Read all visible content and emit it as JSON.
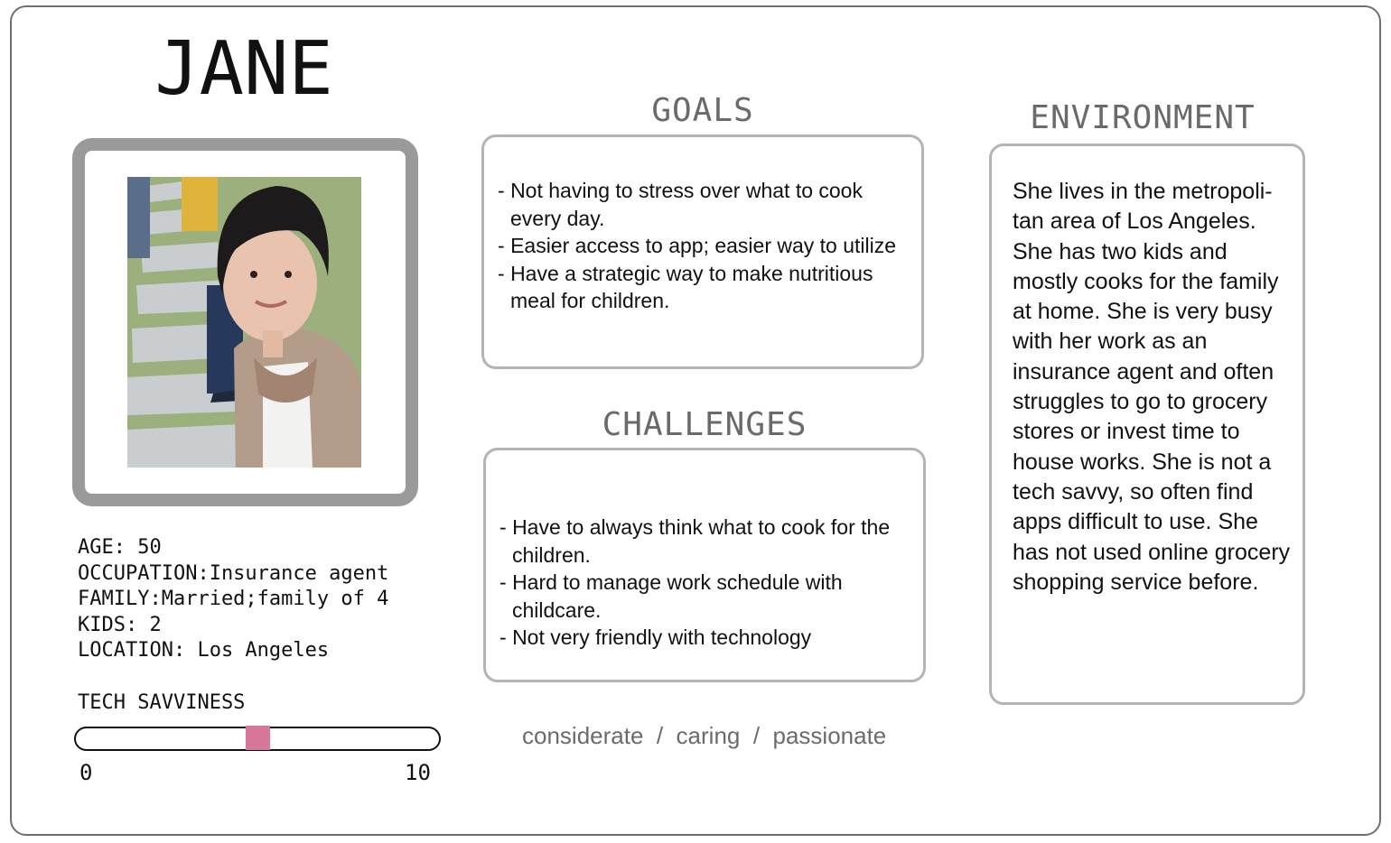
{
  "persona": {
    "name": "JANE",
    "photo_alt": "Portrait of Jane",
    "facts": [
      "AGE: 50",
      "OCCUPATION:Insurance agent",
      "FAMILY:Married;family of 4",
      "KIDS: 2",
      "LOCATION: Los Angeles"
    ],
    "tech_savviness": {
      "label": "TECH SAVVINESS",
      "min_label": "0",
      "max_label": "10",
      "value": 5,
      "accent": "#d7789a"
    }
  },
  "goals": {
    "title": "GOALS",
    "items": [
      "Not having to stress over what to cook every day.",
      "Easier access to app; easier way to utilize",
      "Have a strategic way to make nutritious meal for children."
    ]
  },
  "challenges": {
    "title": "CHALLENGES",
    "items": [
      "Have to always think what to cook for the children.",
      "Hard to manage work schedule with childcare.",
      "Not very friendly with technology"
    ]
  },
  "environment": {
    "title": "ENVIRONMENT",
    "text": "She lives in the metropoli-tan area of Los Angeles. She has two kids and mostly cooks for the family at home. She is very busy with her work as an insurance agent and often struggles to go to grocery stores or invest time to house works. She is not a tech savvy, so often find apps difficult to use. She has not used online grocery shopping service before."
  },
  "traits": {
    "items": [
      "considerate",
      "caring",
      "passionate"
    ],
    "separator": "  /  "
  }
}
